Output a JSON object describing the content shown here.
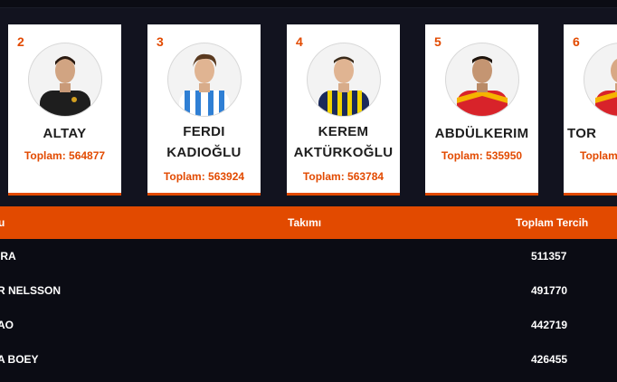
{
  "cards": [
    {
      "rank": "2",
      "name1": "ALTAY",
      "name2": "",
      "total": "Toplam: 564877",
      "kit": "black"
    },
    {
      "rank": "3",
      "name1": "FERDI",
      "name2": "KADIOĞLU",
      "total": "Toplam: 563924",
      "kit": "blue-stripes"
    },
    {
      "rank": "4",
      "name1": "KEREM",
      "name2": "AKTÜRKOĞLU",
      "total": "Toplam: 563784",
      "kit": "navy-yellow"
    },
    {
      "rank": "5",
      "name1": "ABDÜLKERIM",
      "name2": "",
      "total": "Toplam: 535950",
      "kit": "red-yellow"
    },
    {
      "rank": "6",
      "name1": "TOR",
      "name2": "",
      "total": "Toplam",
      "kit": "red-yellow"
    }
  ],
  "table": {
    "headers": {
      "player": "u",
      "team": "Takımı",
      "total": "Toplam Tercih"
    },
    "rows": [
      {
        "player": "IRA",
        "value": "511357"
      },
      {
        "player": "R NELSSON",
        "value": "491770"
      },
      {
        "player": "AO",
        "value": "442719"
      },
      {
        "player": "A BOEY",
        "value": "426455"
      }
    ]
  }
}
